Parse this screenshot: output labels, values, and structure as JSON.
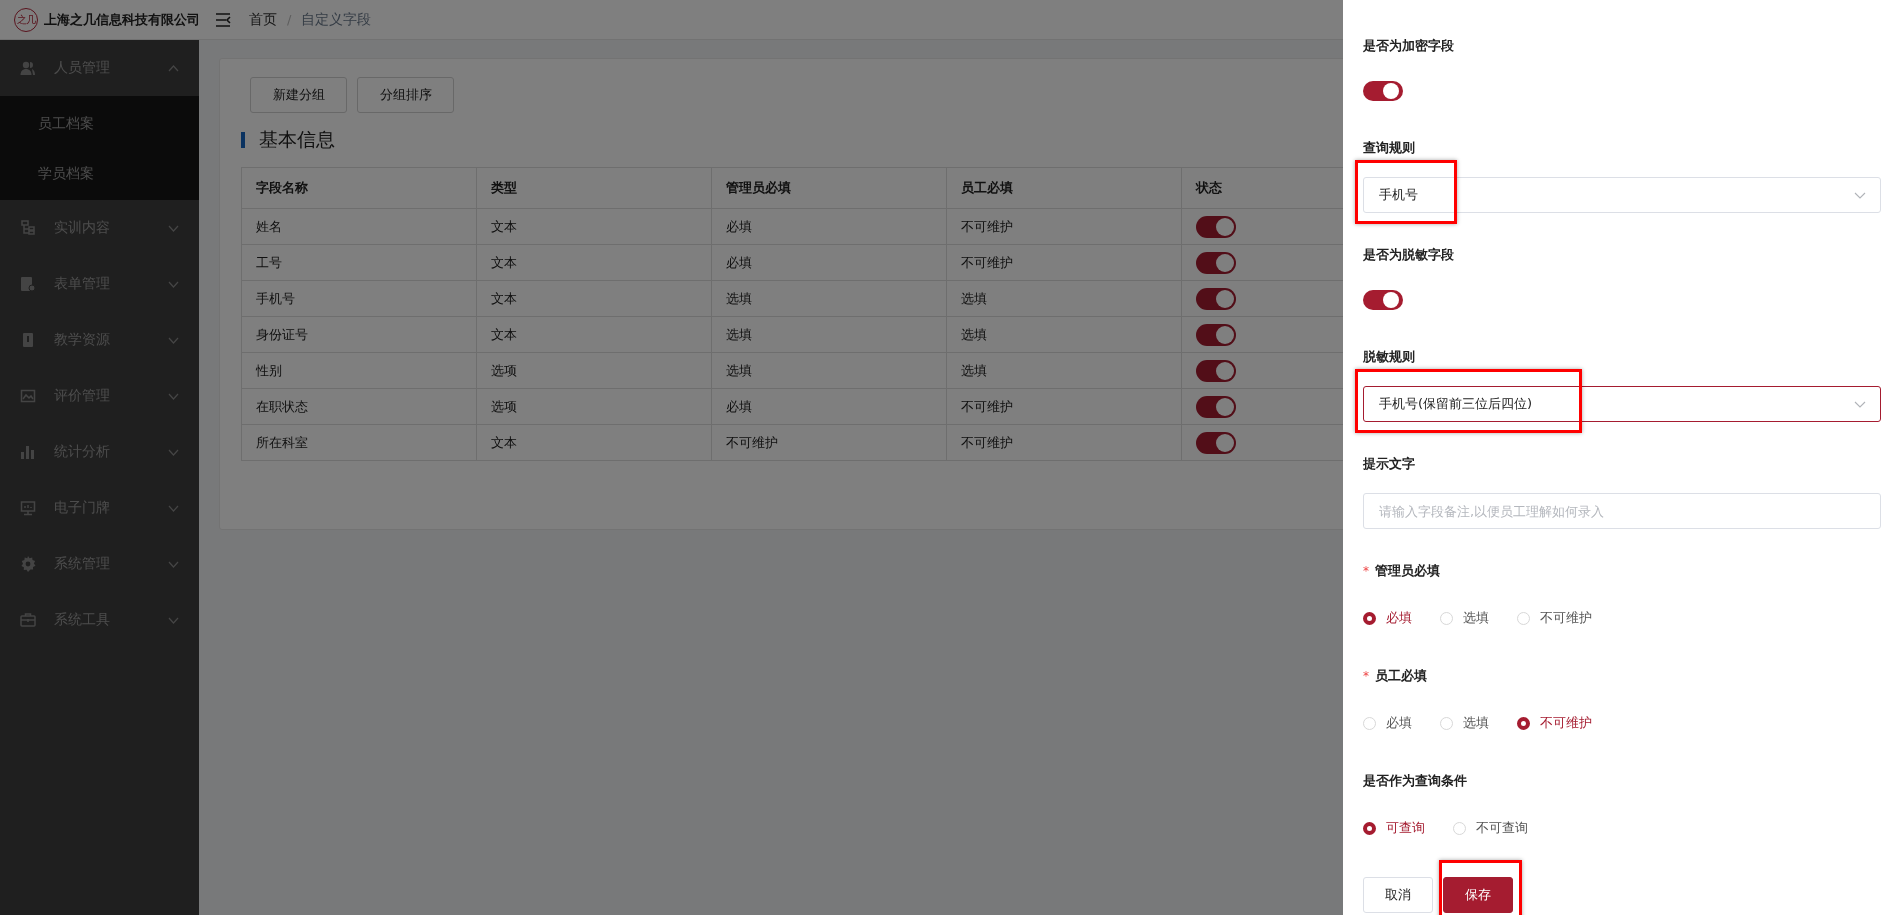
{
  "header": {
    "logo": "之几",
    "company": "上海之几信息科技有限公司",
    "breadcrumb": [
      {
        "label": "首页",
        "current": false
      },
      {
        "label": "自定义字段",
        "current": true
      }
    ],
    "breadcrumb_separator": "/"
  },
  "sidebar": {
    "items": [
      {
        "label": "人员管理",
        "expanded": true,
        "children": [
          {
            "label": "员工档案"
          },
          {
            "label": "学员档案"
          }
        ]
      },
      {
        "label": "实训内容",
        "expanded": false
      },
      {
        "label": "表单管理",
        "expanded": false
      },
      {
        "label": "教学资源",
        "expanded": false
      },
      {
        "label": "评价管理",
        "expanded": false
      },
      {
        "label": "统计分析",
        "expanded": false
      },
      {
        "label": "电子门牌",
        "expanded": false
      },
      {
        "label": "系统管理",
        "expanded": false
      },
      {
        "label": "系统工具",
        "expanded": false
      }
    ]
  },
  "main": {
    "buttons": [
      "新建分组",
      "分组排序"
    ],
    "section_title": "基本信息",
    "table": {
      "columns": [
        "字段名称",
        "类型",
        "管理员必填",
        "员工必填",
        "状态"
      ],
      "rows": [
        {
          "cells": [
            "姓名",
            "文本",
            "必填",
            "不可维护"
          ],
          "on": true
        },
        {
          "cells": [
            "工号",
            "文本",
            "必填",
            "不可维护"
          ],
          "on": true
        },
        {
          "cells": [
            "手机号",
            "文本",
            "选填",
            "选填"
          ],
          "on": true
        },
        {
          "cells": [
            "身份证号",
            "文本",
            "选填",
            "选填"
          ],
          "on": true
        },
        {
          "cells": [
            "性别",
            "选项",
            "选填",
            "选填"
          ],
          "on": true
        },
        {
          "cells": [
            "在职状态",
            "选项",
            "必填",
            "不可维护"
          ],
          "on": true
        },
        {
          "cells": [
            "所在科室",
            "文本",
            "不可维护",
            "不可维护"
          ],
          "on": true
        }
      ]
    }
  },
  "drawer": {
    "fields": [
      {
        "kind": "toggle",
        "label": "是否为加密字段",
        "on": true
      },
      {
        "kind": "select",
        "label": "查询规则",
        "value": "手机号",
        "focused": false,
        "highlighted": true
      },
      {
        "kind": "toggle",
        "label": "是否为脱敏字段",
        "on": true
      },
      {
        "kind": "select",
        "label": "脱敏规则",
        "value": "手机号(保留前三位后四位)",
        "focused": true,
        "highlighted": true
      },
      {
        "kind": "input",
        "label": "提示文字",
        "placeholder": "请输入字段备注,以便员工理解如何录入"
      },
      {
        "kind": "radio",
        "label": "管理员必填",
        "required_mark": "*",
        "options": [
          {
            "label": "必填",
            "selected": true
          },
          {
            "label": "选填",
            "selected": false
          },
          {
            "label": "不可维护",
            "selected": false
          }
        ]
      },
      {
        "kind": "radio",
        "label": "员工必填",
        "required_mark": "*",
        "options": [
          {
            "label": "必填",
            "selected": false
          },
          {
            "label": "选填",
            "selected": false
          },
          {
            "label": "不可维护",
            "selected": true
          }
        ]
      },
      {
        "kind": "radio",
        "label": "是否作为查询条件",
        "options": [
          {
            "label": "可查询",
            "selected": true
          },
          {
            "label": "不可查询",
            "selected": false
          }
        ]
      }
    ],
    "buttons": [
      {
        "label": "取消",
        "kind": "default"
      },
      {
        "label": "保存",
        "kind": "primary",
        "highlighted": true
      }
    ]
  }
}
